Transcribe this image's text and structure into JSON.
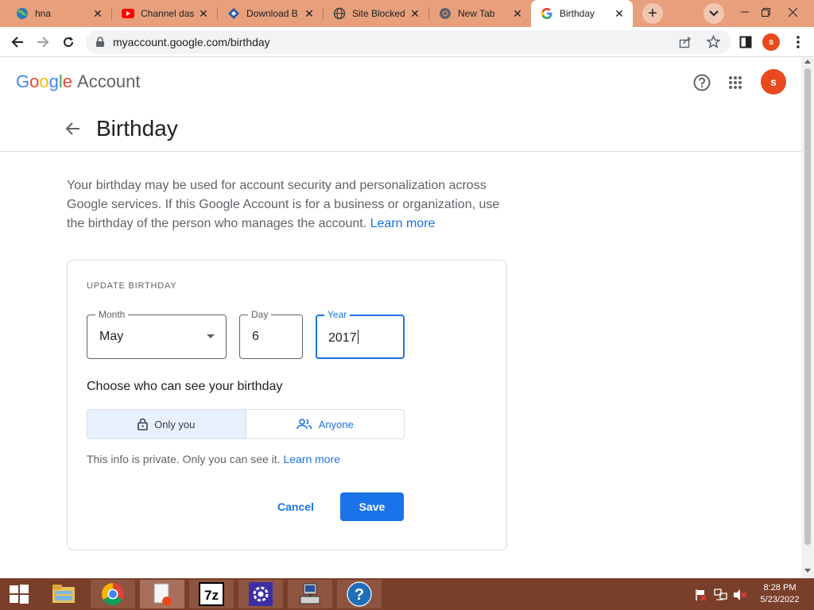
{
  "browser": {
    "tabs": [
      {
        "title": "hna",
        "icon": "globe-icon"
      },
      {
        "title": "Channel das",
        "icon": "youtube-icon"
      },
      {
        "title": "Download B",
        "icon": "download-site-icon"
      },
      {
        "title": "Site Blocked",
        "icon": "globe-icon"
      },
      {
        "title": "New Tab",
        "icon": "chrome-icon"
      },
      {
        "title": "Birthday",
        "icon": "google-icon"
      }
    ],
    "url": "myaccount.google.com/birthday",
    "profile_initial": "s"
  },
  "header": {
    "logo_letters": [
      "G",
      "o",
      "o",
      "g",
      "l",
      "e"
    ],
    "logo_colors": [
      "#4285f4",
      "#ea4335",
      "#fbbc05",
      "#4285f4",
      "#34a853",
      "#ea4335"
    ],
    "product": "Account",
    "avatar_initial": "s",
    "avatar_color": "#e8491d"
  },
  "page": {
    "title": "Birthday",
    "description": "Your birthday may be used for account security and personalization across Google services. If this Google Account is for a business or organization, use the birthday of the person who manages the account.",
    "learn_more": "Learn more"
  },
  "card": {
    "heading": "UPDATE BIRTHDAY",
    "month": {
      "label": "Month",
      "value": "May"
    },
    "day": {
      "label": "Day",
      "value": "6"
    },
    "year": {
      "label": "Year",
      "value": "2017"
    },
    "visibility_title": "Choose who can see your birthday",
    "visibility_options": [
      {
        "label": "Only you",
        "icon": "lock-icon",
        "selected": true
      },
      {
        "label": "Anyone",
        "icon": "people-icon",
        "selected": false
      }
    ],
    "private_note": "This info is private. Only you can see it.",
    "private_learn_more": "Learn more",
    "cancel_label": "Cancel",
    "save_label": "Save"
  },
  "taskbar": {
    "apps": [
      "file-explorer-icon",
      "chrome-icon",
      "notepad-icon",
      "7zip-icon",
      "settings-app-icon",
      "network-computer-icon",
      "help-icon"
    ],
    "time": "8:28 PM",
    "date": "5/23/2022"
  },
  "colors": {
    "accent": "#1a73e8",
    "tabstrip": "#e8a07c",
    "taskbar": "#7a3f2a"
  }
}
